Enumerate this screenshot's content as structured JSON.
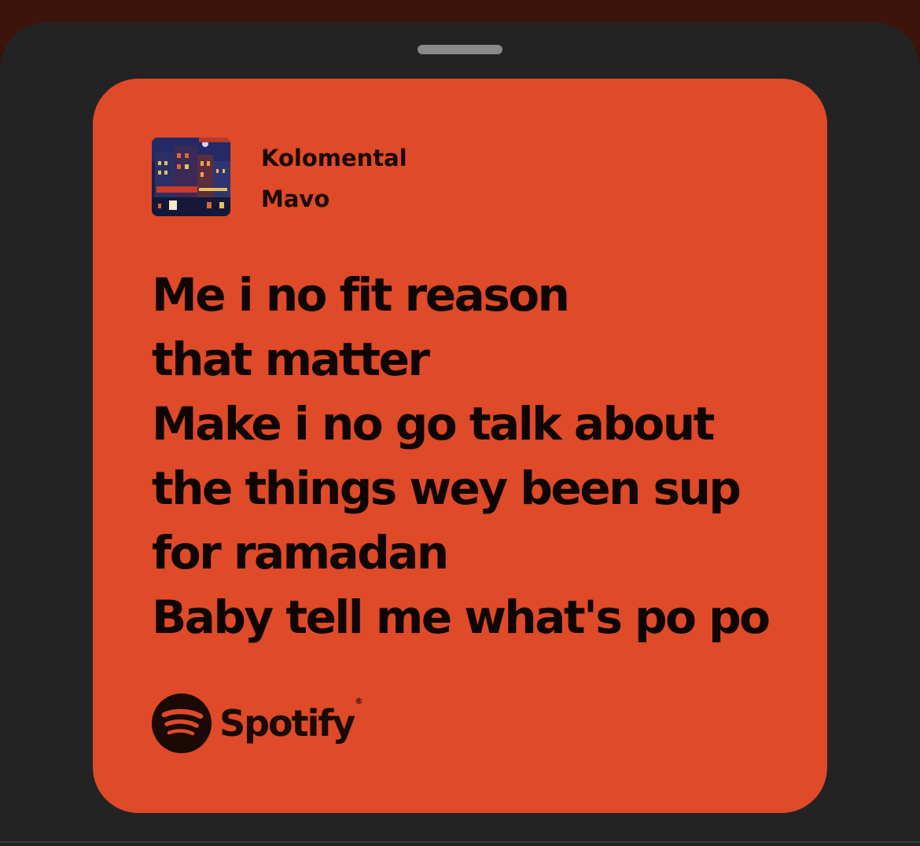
{
  "colors": {
    "card_background": "#df4a28",
    "sheet_background": "#232323",
    "text": "#0f0503"
  },
  "track": {
    "title": "Kolomental",
    "artist": "Mavo",
    "cover_icon": "album-cover-art"
  },
  "lyrics": [
    "Me i no fit reason",
    "that matter",
    "Make i no go talk about",
    "the things wey been sup",
    "for ramadan",
    "Baby tell me what's po po"
  ],
  "brand": {
    "icon": "spotify-logo-icon",
    "name": "Spotify",
    "trademark": "®"
  }
}
